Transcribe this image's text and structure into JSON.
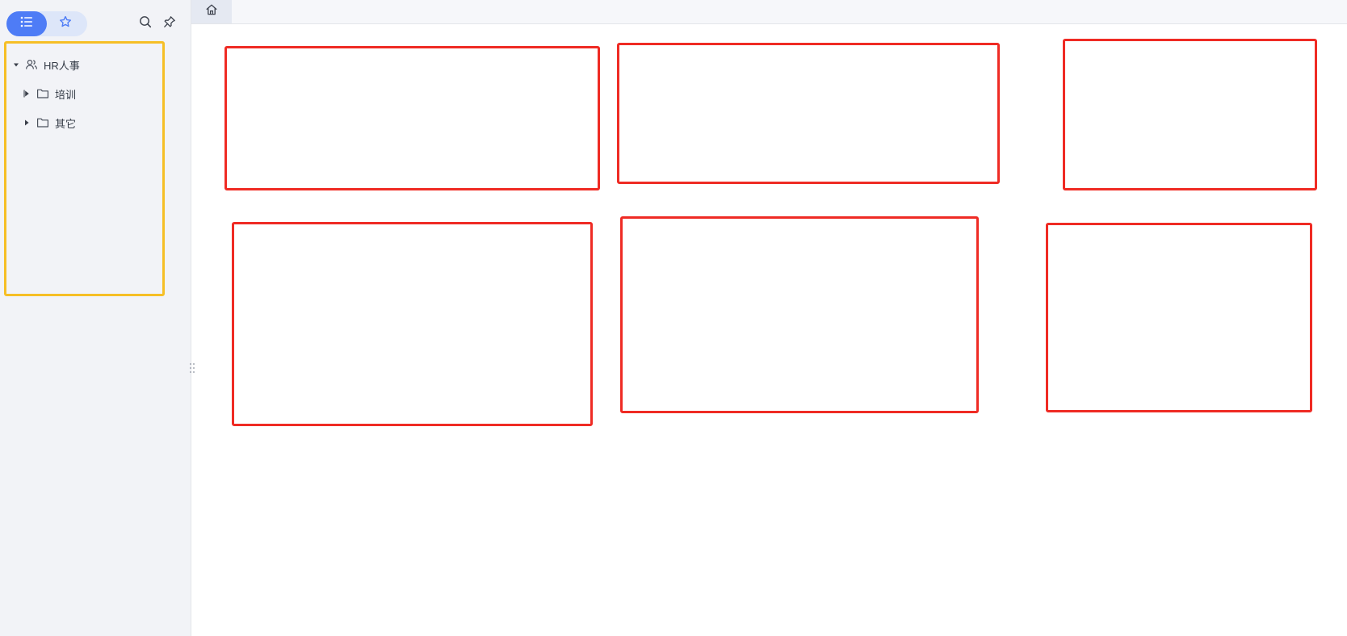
{
  "sidebar": {
    "view_toggle": {
      "list_icon": "list-icon",
      "favorites_icon": "star-icon"
    },
    "tools": {
      "search_icon": "search-icon",
      "pin_icon": "pin-icon"
    },
    "tree": {
      "root": {
        "label": "HR人事",
        "icon": "users-icon",
        "expanded": true
      },
      "children": [
        {
          "label": "培训",
          "icon": "folder-icon",
          "expanded": false
        },
        {
          "label": "其它",
          "icon": "folder-icon",
          "expanded": false
        }
      ]
    }
  },
  "tabs": {
    "home_icon": "home-icon"
  },
  "colors": {
    "accent": "#4e7cf6",
    "sidebar_bg": "#f2f3f7",
    "highlight_yellow": "#f6bf26",
    "highlight_red": "#ef2b24"
  }
}
